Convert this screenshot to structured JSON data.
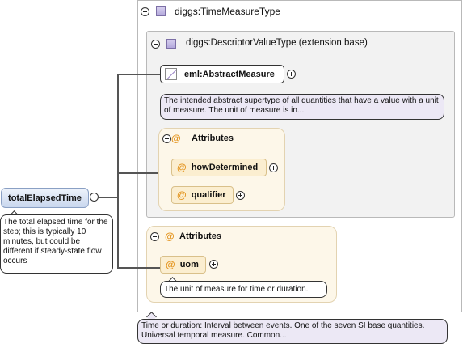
{
  "root_element": {
    "name": "totalElapsedTime",
    "documentation": "The total elapsed time for the step; this is typically 10 minutes, but could be different if steady-state flow occurs"
  },
  "complex_type": {
    "name": "diggs:TimeMeasureType",
    "documentation": "Time or duration: Interval between events. One of the seven SI base quantities. Universal temporal measure. Common..."
  },
  "extension": {
    "label": "diggs:DescriptorValueType (extension base)"
  },
  "abstract_element": {
    "name": "eml:AbstractMeasure",
    "documentation": "The intended abstract supertype of all quantities that have a value with a unit of measure. The unit of measure is in..."
  },
  "inherited_attributes": {
    "title": "Attributes",
    "items": [
      {
        "name": "howDetermined"
      },
      {
        "name": "qualifier"
      }
    ]
  },
  "own_attributes": {
    "title": "Attributes",
    "items": [
      {
        "name": "uom",
        "documentation": "The unit of measure for time or duration."
      }
    ]
  },
  "icons": {
    "type": "complex-type-icon",
    "abstract": "abstract-element-icon",
    "attribute": "@"
  },
  "colors": {
    "attribute_at": "#e3931b",
    "doc_background": "#ece8f5",
    "attr_group_background": "#fdf7e9",
    "root_element_gradient_end": "#c9d7ee"
  }
}
